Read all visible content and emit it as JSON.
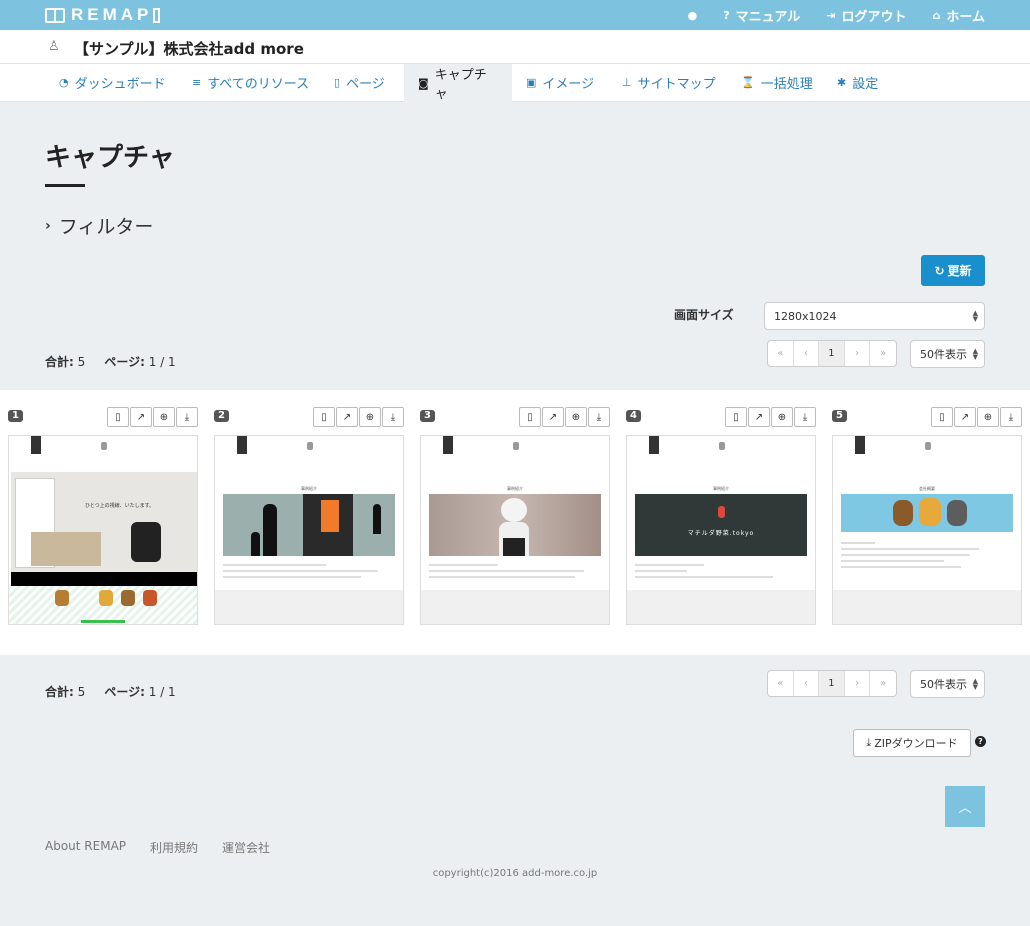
{
  "app": {
    "logo": "REMAP",
    "topnav": [
      {
        "icon": "user-icon",
        "label": ""
      },
      {
        "icon": "question-icon",
        "label": "マニュアル"
      },
      {
        "icon": "logout-icon",
        "label": "ログアウト"
      },
      {
        "icon": "home-icon",
        "label": "ホーム"
      }
    ]
  },
  "project": {
    "title": "【サンプル】株式会社add more"
  },
  "tabs": [
    {
      "icon": "dashboard-icon",
      "label": "ダッシュボード",
      "active": false
    },
    {
      "icon": "database-icon",
      "label": "すべてのリソース",
      "active": false
    },
    {
      "icon": "file-icon",
      "label": "ページ",
      "active": false
    },
    {
      "icon": "camera-icon",
      "label": "キャプチャ",
      "active": true
    },
    {
      "icon": "image-icon",
      "label": "イメージ",
      "active": false
    },
    {
      "icon": "sitemap-icon",
      "label": "サイトマップ",
      "active": false
    },
    {
      "icon": "hourglass-icon",
      "label": "一括処理",
      "active": false
    },
    {
      "icon": "gear-icon",
      "label": "設定",
      "active": false
    }
  ],
  "page": {
    "heading": "キャプチャ",
    "filter_label": "フィルター",
    "refresh_label": "更新",
    "screen_size_label": "画面サイズ",
    "screen_size_value": "1280x1024"
  },
  "summary": {
    "total_label": "合計:",
    "total_value": "5",
    "page_label": "ページ:",
    "page_value": "1 / 1",
    "per_page": "50件表示",
    "pager": [
      "«",
      "‹",
      "1",
      "›",
      "»"
    ]
  },
  "captures": [
    {
      "number": "1",
      "heading": "",
      "hero_caption": "ひとつ上の視線、いたします。"
    },
    {
      "number": "2",
      "heading": "事例紹介",
      "hero_caption": ""
    },
    {
      "number": "3",
      "heading": "事例紹介",
      "hero_caption": ""
    },
    {
      "number": "4",
      "heading": "事例紹介",
      "hero_caption": "マチルダ野菜.tokyo"
    },
    {
      "number": "5",
      "heading": "会社概要",
      "hero_caption": ""
    }
  ],
  "zip_label": "ZIPダウンロード",
  "footer": {
    "links": [
      "About REMAP",
      "利用規約",
      "運営会社"
    ],
    "copyright": "copyright(c)2016 add-more.co.jp"
  },
  "colors": {
    "topbar": "#7dc3e0",
    "link": "#2a7fb8",
    "primary": "#1a8fcd"
  }
}
